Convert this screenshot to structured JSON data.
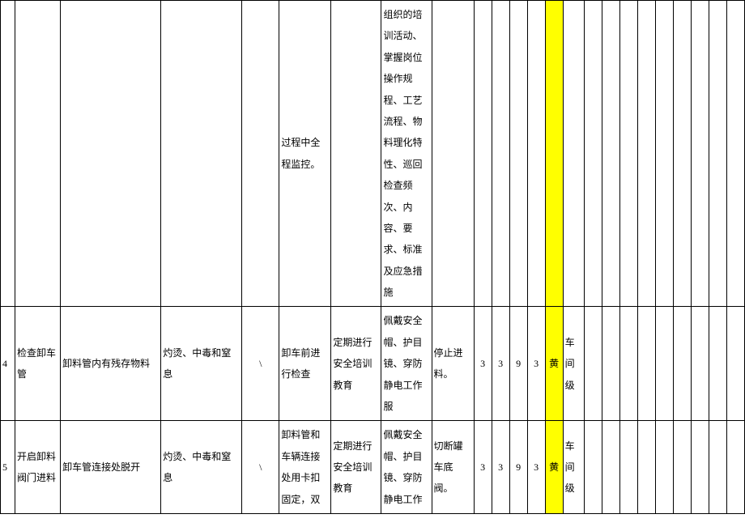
{
  "rows": [
    {
      "num": "",
      "c1": "",
      "c2": "",
      "c3": "",
      "c4": "",
      "c5": "过程中全程监控。",
      "c6": "",
      "c7": "组织的培训活动、掌握岗位操作规程、工艺流程、物料理化特性、巡回检查频次、内容、要求、标准及应急措施",
      "c8": "",
      "c9": "",
      "c10": "",
      "c11": "",
      "c12": "",
      "c13": "",
      "c14": "",
      "c15": "",
      "c16": "",
      "c17": "",
      "c18": "",
      "c19": "",
      "c20": "",
      "c21": "",
      "c22": "",
      "c23": ""
    },
    {
      "num": "4",
      "c1": "检查卸车管",
      "c2": "卸料管内有残存物料",
      "c3": "灼烫、中毒和窒息",
      "c4": "\\",
      "c5": "卸车前进行检查",
      "c6": "定期进行安全培训教育",
      "c7": "佩戴安全帽、护目镜、穿防静电工作服",
      "c8": "停止进料。",
      "c9": "3",
      "c10": "3",
      "c11": "9",
      "c12": "3",
      "c13": "黄",
      "c14": "车间级",
      "c15": "",
      "c16": "",
      "c17": "",
      "c18": "",
      "c19": "",
      "c20": "",
      "c21": "",
      "c22": "",
      "c23": ""
    },
    {
      "num": "5",
      "c1": "开启卸料阀门进料",
      "c2": "卸车管连接处脱开",
      "c3": "灼烫、中毒和窒息",
      "c4": "\\",
      "c5": "卸料管和车辆连接处用卡扣固定，双",
      "c6": "定期进行安全培训教育",
      "c7": "佩戴安全帽、护目镜、穿防静电工作",
      "c8": "切断罐车底阀。",
      "c9": "3",
      "c10": "3",
      "c11": "9",
      "c12": "3",
      "c13": "黄",
      "c14": "车间级",
      "c15": "",
      "c16": "",
      "c17": "",
      "c18": "",
      "c19": "",
      "c20": "",
      "c21": "",
      "c22": "",
      "c23": ""
    }
  ]
}
